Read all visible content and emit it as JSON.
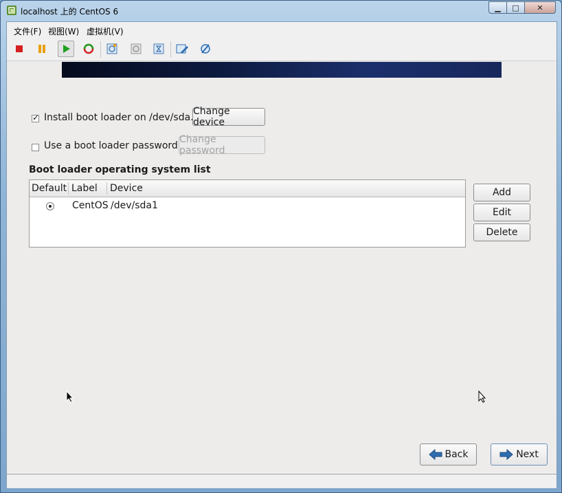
{
  "window": {
    "title": "localhost 上的 CentOS 6"
  },
  "menu": {
    "file": "文件(F)",
    "view": "视图(W)",
    "vm": "虚拟机(V)"
  },
  "toolbar": {
    "icons": [
      "stop-icon",
      "pause-icon",
      "play-icon",
      "reset-icon",
      "snapshot-icon",
      "revert-snapshot-icon",
      "manage-snapshots-icon",
      "edit-settings-icon",
      "vm-settings-icon"
    ]
  },
  "installer": {
    "install_bootloader_label": "Install boot loader on /dev/sda.",
    "install_bootloader_checked": true,
    "change_device_label": "Change device",
    "password_label": "Use a boot loader password",
    "password_checked": false,
    "change_password_label": "Change password",
    "os_list_title": "Boot loader operating system list",
    "columns": [
      "Default",
      "Label",
      "Device"
    ],
    "rows": [
      {
        "default": true,
        "label": "CentOS",
        "device": "/dev/sda1"
      }
    ],
    "add_label": "Add",
    "edit_label": "Edit",
    "delete_label": "Delete",
    "back_label": "Back",
    "next_label": "Next"
  }
}
